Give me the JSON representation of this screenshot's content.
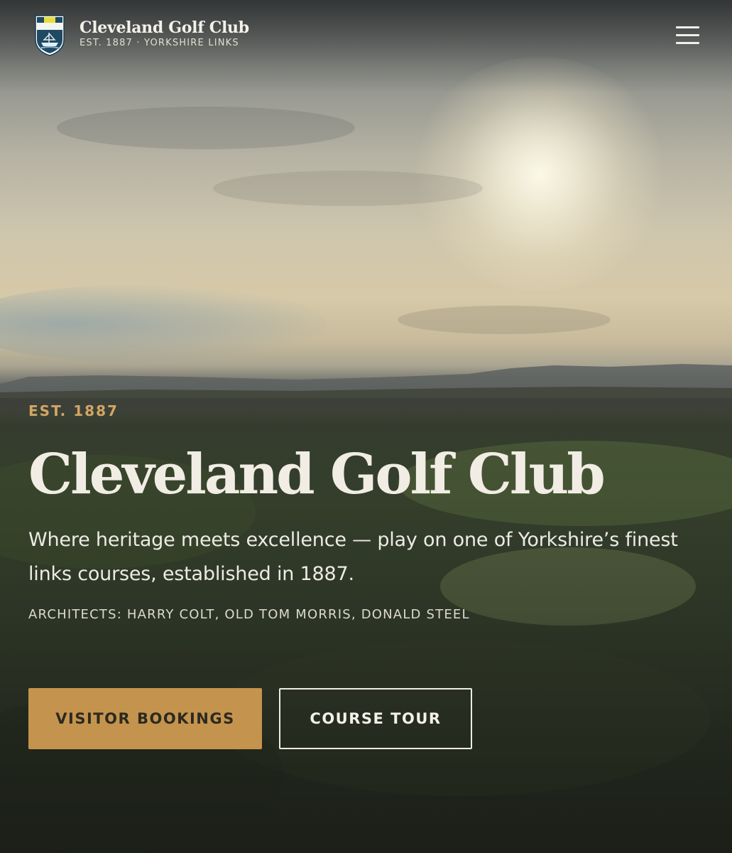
{
  "header": {
    "brand_name": "Cleveland Golf Club",
    "brand_tagline": "EST. 1887 · YORKSHIRE LINKS",
    "crest_icon": "club-crest-icon",
    "menu_icon": "hamburger-menu-icon"
  },
  "hero": {
    "eyebrow": "EST. 1887",
    "title": "Cleveland Golf Club",
    "lead": "Where heritage meets excellence — play on one of Yorkshire’s finest links courses, established in 1887.",
    "architects": "ARCHITECTS: HARRY COLT, OLD TOM MORRIS, DONALD STEEL",
    "primary_cta": "VISITOR BOOKINGS",
    "secondary_cta": "COURSE TOUR"
  },
  "colors": {
    "accent_gold": "#c4944f",
    "eyebrow_gold": "#d2a665",
    "text_light": "#f1ede4",
    "button_text_dark": "#2c2a1e"
  }
}
